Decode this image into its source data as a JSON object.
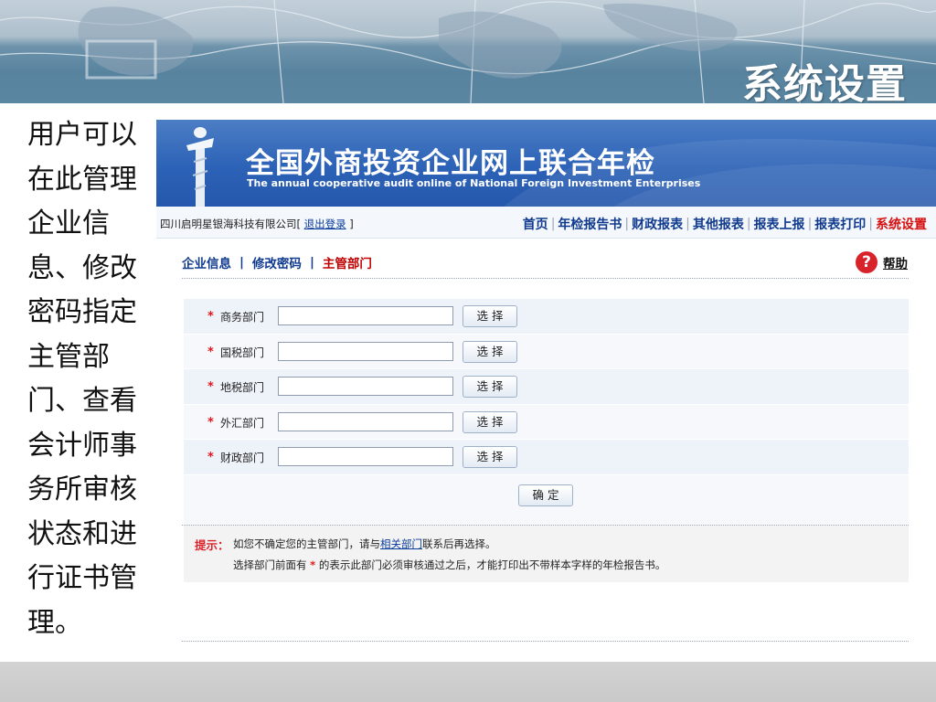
{
  "slide": {
    "title": "系统设置",
    "caption": "用户可以在此管理企业信息、修改密码指定主管部门、查看会计师事务所审核状态和进行证书管理。"
  },
  "site": {
    "title": "全国外商投资企业网上联合年检",
    "subtitle": "The annual cooperative audit online  of National Foreign Investment Enterprises"
  },
  "user_bar": {
    "company": "四川启明星银海科技有限公司[ ",
    "logout": "退出登录",
    "suffix": " ]"
  },
  "nav": {
    "items": [
      {
        "label": "首页",
        "active": false
      },
      {
        "label": "年检报告书",
        "active": false
      },
      {
        "label": "财政报表",
        "active": false
      },
      {
        "label": "其他报表",
        "active": false
      },
      {
        "label": "报表上报",
        "active": false
      },
      {
        "label": "报表打印",
        "active": false
      },
      {
        "label": "系统设置",
        "active": true
      }
    ]
  },
  "subnav": {
    "tabs": [
      {
        "label": "企业信息",
        "active": false
      },
      {
        "label": "修改密码",
        "active": false
      },
      {
        "label": "主管部门",
        "active": true
      }
    ],
    "separator": "|",
    "help_icon": "?",
    "help_label": "帮助"
  },
  "form": {
    "required_mark": "*",
    "select_label": "选 择",
    "rows": [
      {
        "label": "商务部门",
        "value": ""
      },
      {
        "label": "国税部门",
        "value": ""
      },
      {
        "label": "地税部门",
        "value": ""
      },
      {
        "label": "外汇部门",
        "value": ""
      },
      {
        "label": "财政部门",
        "value": ""
      }
    ],
    "confirm_label": "确 定"
  },
  "tips": {
    "label": "提示：",
    "line1_a": "如您不确定您的主管部门，请与",
    "line1_link": "相关部门",
    "line1_b": "联系后再选择。",
    "line2_a": "选择部门前面有 ",
    "line2_star": "*",
    "line2_b": " 的表示此部门必须审核通过之后，才能打印出不带样本字样的年检报告书。"
  },
  "colors": {
    "header_blue": "#2c62b7",
    "active_red": "#d60f0f",
    "link_blue": "#0f3a8e",
    "required_red": "#e0161c"
  }
}
